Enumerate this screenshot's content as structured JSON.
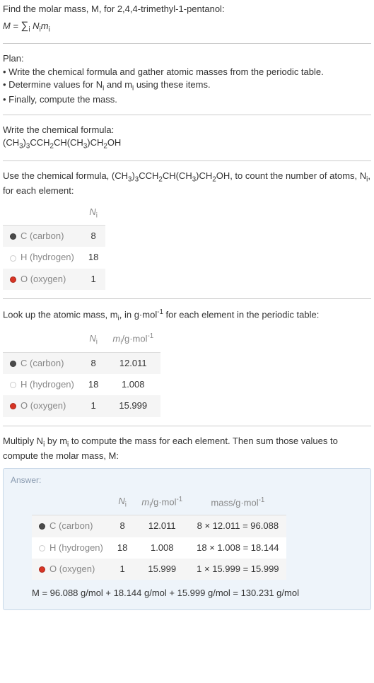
{
  "intro": {
    "line1": "Find the molar mass, M, for 2,4,4-trimethyl-1-pentanol:",
    "formula_text": "M = ∑",
    "formula_sub": "i",
    "formula_rest": " N",
    "formula_i1": "i",
    "formula_m": "m",
    "formula_i2": "i"
  },
  "plan": {
    "heading": "Plan:",
    "b1": "• Write the chemical formula and gather atomic masses from the periodic table.",
    "b2_a": "• Determine values for N",
    "b2_b": " and m",
    "b2_c": " using these items.",
    "b3": "• Finally, compute the mass."
  },
  "chemformula": {
    "heading": "Write the chemical formula:",
    "part1": "(CH",
    "s1": "3",
    "part2": ")",
    "s2": "3",
    "part3": "CCH",
    "s3": "2",
    "part4": "CH(CH",
    "s4": "3",
    "part5": ")CH",
    "s5": "2",
    "part6": "OH"
  },
  "count": {
    "line_a": "Use the chemical formula, (CH",
    "s1": "3",
    "line_b": ")",
    "s2": "3",
    "line_c": "CCH",
    "s3": "2",
    "line_d": "CH(CH",
    "s4": "3",
    "line_e": ")CH",
    "s5": "2",
    "line_f": "OH, to count the number of atoms, N",
    "line_g": ", for each element:",
    "head_ni_n": "N",
    "head_ni_i": "i",
    "rows": [
      {
        "label": "C (carbon)",
        "ni": "8"
      },
      {
        "label": "H (hydrogen)",
        "ni": "18"
      },
      {
        "label": "O (oxygen)",
        "ni": "1"
      }
    ]
  },
  "lookup": {
    "line_a": "Look up the atomic mass, m",
    "line_b": ", in g·mol",
    "line_c": " for each element in the periodic table:",
    "exp": "-1",
    "head_mi_m": "m",
    "head_mi_i": "i",
    "head_mi_unit": "/g·mol",
    "head_mi_exp": "-1",
    "rows": [
      {
        "label": "C (carbon)",
        "ni": "8",
        "mi": "12.011"
      },
      {
        "label": "H (hydrogen)",
        "ni": "18",
        "mi": "1.008"
      },
      {
        "label": "O (oxygen)",
        "ni": "1",
        "mi": "15.999"
      }
    ]
  },
  "multiply": {
    "line_a": "Multiply N",
    "line_b": " by m",
    "line_c": " to compute the mass for each element. Then sum those values to compute the molar mass, M:"
  },
  "answer": {
    "label": "Answer:",
    "mass_head": "mass/g·mol",
    "mass_exp": "-1",
    "rows": [
      {
        "label": "C (carbon)",
        "ni": "8",
        "mi": "12.011",
        "mass": "8 × 12.011 = 96.088"
      },
      {
        "label": "H (hydrogen)",
        "ni": "18",
        "mi": "1.008",
        "mass": "18 × 1.008 = 18.144"
      },
      {
        "label": "O (oxygen)",
        "ni": "1",
        "mi": "15.999",
        "mass": "1 × 15.999 = 15.999"
      }
    ],
    "final": "M = 96.088 g/mol + 18.144 g/mol + 15.999 g/mol = 130.231 g/mol"
  },
  "sub_i": "i"
}
